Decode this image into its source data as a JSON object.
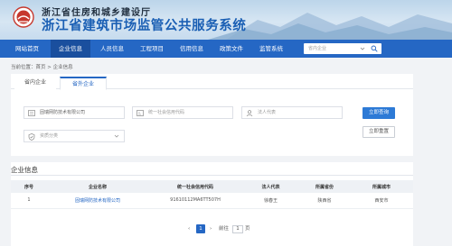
{
  "header": {
    "org_name": "浙江省住房和城乡建设厅",
    "system_name": "浙江省建筑市场监管公共服务系统"
  },
  "nav": {
    "items": [
      "网站首页",
      "企业信息",
      "人员信息",
      "工程项目",
      "信用信息",
      "政策文件",
      "监管系统"
    ],
    "active_index": 1,
    "search_placeholder": "省内企业"
  },
  "breadcrumb": {
    "prefix": "当前位置：",
    "home": "首页",
    "sep": ">",
    "current": "企业信息"
  },
  "search": {
    "tabs": [
      "省内企业",
      "省外企业"
    ],
    "active_tab": 1,
    "company_name_value": "固瑞网防技术有限公司",
    "credit_code_placeholder": "统一社会信用代码",
    "legal_rep_placeholder": "法人代表",
    "qualification_placeholder": "资质分类",
    "query_button": "立即查询",
    "reset_button": "立即重置"
  },
  "results": {
    "title": "企业信息",
    "columns": [
      "序号",
      "企业名称",
      "统一社会信用代码",
      "法人代表",
      "所属省份",
      "所属城市"
    ],
    "rows": [
      [
        "1",
        "固瑞网防技术有限公司",
        "91610112MA6TT507H",
        "徐春王",
        "陕西省",
        "西安市"
      ]
    ]
  },
  "pagination": {
    "prev": "‹",
    "current_page": "1",
    "next": "›",
    "goto_label": "前往",
    "goto_value": "1",
    "page_suffix": "页"
  },
  "colors": {
    "nav_blue": "#2567c4",
    "nav_active": "#1a4f9e",
    "link_blue": "#2567c4",
    "button_blue": "#2d7ad6"
  }
}
